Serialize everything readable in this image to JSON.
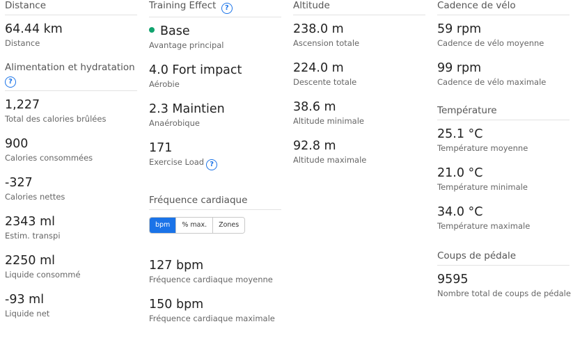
{
  "colors": {
    "accent": "#1a73e8",
    "base_dot": "#11a36e"
  },
  "distance": {
    "title": "Distance",
    "stats": [
      {
        "value": "64.44 km",
        "label": "Distance"
      }
    ]
  },
  "nutrition": {
    "title": "Alimentation et hydratation",
    "help_icon": "?",
    "stats": [
      {
        "value": "1,227",
        "label": "Total des calories brûlées"
      },
      {
        "value": "900",
        "label": "Calories consommées"
      },
      {
        "value": "-327",
        "label": "Calories nettes"
      },
      {
        "value": "2343 ml",
        "label": "Estim. transpi"
      },
      {
        "value": "2250 ml",
        "label": "Liquide consommé"
      },
      {
        "value": "-93 ml",
        "label": "Liquide net"
      }
    ]
  },
  "training_effect": {
    "title": "Training Effect",
    "help_icon": "?",
    "stats": [
      {
        "value": "Base",
        "label": "Avantage principal"
      },
      {
        "value": "4.0 Fort impact",
        "label": "Aérobie"
      },
      {
        "value": "2.3 Maintien",
        "label": "Anaérobique"
      },
      {
        "value": "171",
        "label": "Exercise Load"
      }
    ]
  },
  "heart_rate": {
    "title": "Fréquence cardiaque",
    "toggle": [
      "bpm",
      "% max.",
      "Zones"
    ],
    "active_toggle": "bpm",
    "stats": [
      {
        "value": "127 bpm",
        "label": "Fréquence cardiaque moyenne"
      },
      {
        "value": "150 bpm",
        "label": "Fréquence cardiaque maximale"
      }
    ]
  },
  "altitude": {
    "title": "Altitude",
    "stats": [
      {
        "value": "238.0 m",
        "label": "Ascension totale"
      },
      {
        "value": "224.0 m",
        "label": "Descente totale"
      },
      {
        "value": "38.6 m",
        "label": "Altitude minimale"
      },
      {
        "value": "92.8 m",
        "label": "Altitude maximale"
      }
    ]
  },
  "cadence": {
    "title": "Cadence de vélo",
    "stats": [
      {
        "value": "59 rpm",
        "label": "Cadence de vélo moyenne"
      },
      {
        "value": "99 rpm",
        "label": "Cadence de vélo maximale"
      }
    ]
  },
  "temperature": {
    "title": "Température",
    "stats": [
      {
        "value": "25.1 °C",
        "label": "Température moyenne"
      },
      {
        "value": "21.0 °C",
        "label": "Température minimale"
      },
      {
        "value": "34.0 °C",
        "label": "Température maximale"
      }
    ]
  },
  "strokes": {
    "title": "Coups de pédale",
    "stats": [
      {
        "value": "9595",
        "label": "Nombre total de coups de pédale"
      }
    ]
  }
}
